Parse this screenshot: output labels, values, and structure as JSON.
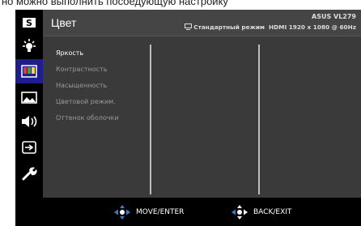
{
  "top_text": "но можно выполнить посоедующую настройку",
  "header": {
    "title": "Цвет",
    "model": "ASUS VL279",
    "mode": "Стандартный режим",
    "signal": "HDMI 1920 x 1080 @ 60Hz"
  },
  "sidebar": {
    "items": [
      {
        "icon": "splendid-s-icon"
      },
      {
        "icon": "bluelight-filter-icon"
      },
      {
        "icon": "color-bars-icon",
        "active": true
      },
      {
        "icon": "image-icon"
      },
      {
        "icon": "sound-icon"
      },
      {
        "icon": "input-select-icon"
      },
      {
        "icon": "wrench-icon"
      }
    ]
  },
  "menu": {
    "items": [
      {
        "label": "Яркость",
        "selected": true
      },
      {
        "label": "Контрастность"
      },
      {
        "label": "Насыщенность"
      },
      {
        "label": "Цветовой режим."
      },
      {
        "label": "Оттенок оболочки"
      }
    ]
  },
  "footer": {
    "move_label": "MOVE/ENTER",
    "back_label": "BACK/EXIT"
  },
  "colors": {
    "accent": "#1e1e8c",
    "panel": "#3a3a3a",
    "header": "#454545",
    "joystick_blue": "#3a7bd5"
  }
}
